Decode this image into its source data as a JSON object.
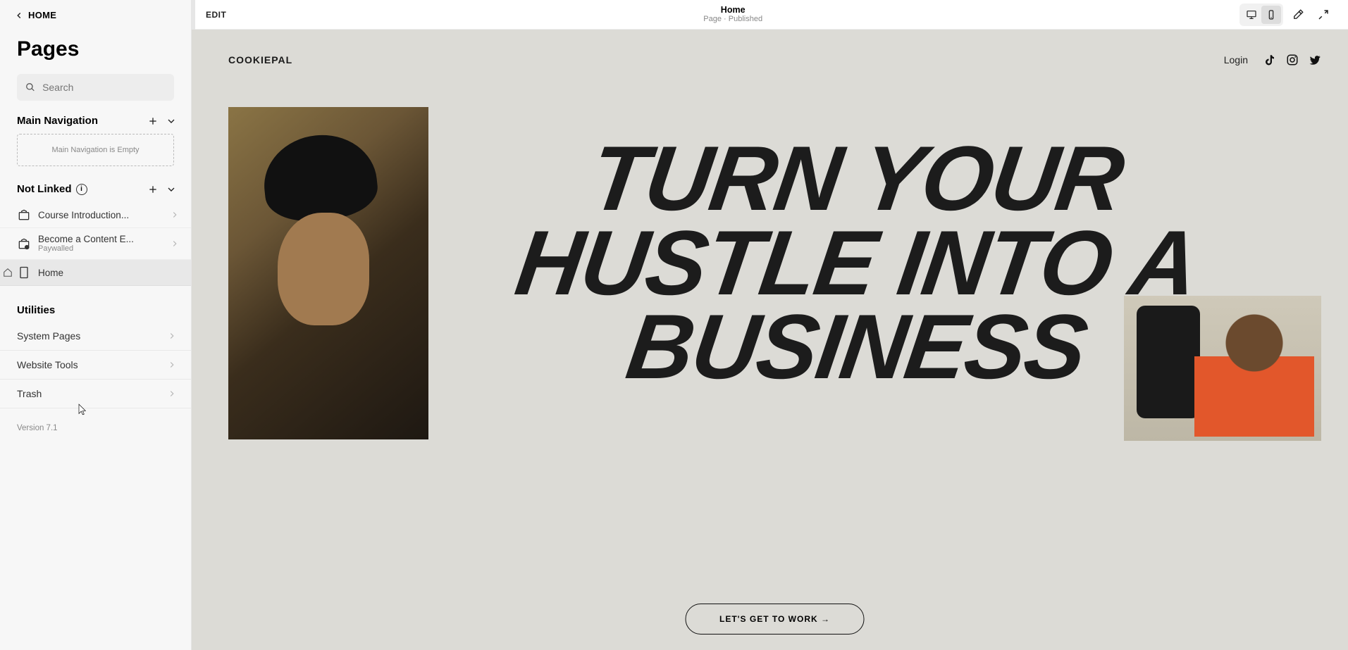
{
  "back_nav": "HOME",
  "sidebar": {
    "title": "Pages",
    "search_placeholder": "Search",
    "main_nav": {
      "label": "Main Navigation",
      "empty_text": "Main Navigation is Empty"
    },
    "not_linked": {
      "label": "Not Linked",
      "items": [
        {
          "label": "Course Introduction...",
          "sub": ""
        },
        {
          "label": "Become a Content E...",
          "sub": "Paywalled"
        },
        {
          "label": "Home",
          "sub": ""
        }
      ]
    },
    "utilities": {
      "label": "Utilities",
      "items": [
        "System Pages",
        "Website Tools",
        "Trash"
      ]
    },
    "version": "Version 7.1"
  },
  "topbar": {
    "edit": "EDIT",
    "title": "Home",
    "subtitle": "Page · Published"
  },
  "site": {
    "brand": "COOKIEPAL",
    "login": "Login",
    "headline_l1": "TURN YOUR",
    "headline_l2": "HUSTLE INTO A",
    "headline_l3": "BUSINESS",
    "cta": "LET'S GET TO WORK →"
  }
}
